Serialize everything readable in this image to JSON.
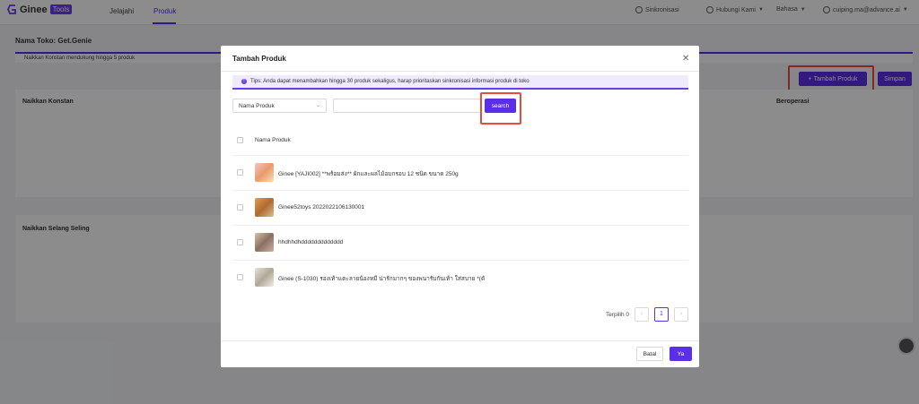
{
  "app": {
    "logo_text": "Ginee",
    "logo_badge": "Tools",
    "nav": [
      {
        "label": "Jelajahi"
      },
      {
        "label": "Produk"
      }
    ],
    "top_right": {
      "sync": "Sinkronisasi",
      "contact": "Hubungi Kami",
      "language": "Bahasa",
      "user": "cuiping.ma@advance.ai"
    },
    "accent_color": "#5b2ee8"
  },
  "page": {
    "store_title": "Nama Toko: Get.Genie",
    "tip": "Naikkan Konstan mendukung hingga 5 produk",
    "add_button": "+ Tambah Produk",
    "save_button": "Simpan",
    "section1_label": "Naikkan Konstan",
    "section1_op": "Beroperasi",
    "section2_label": "Naikkan Selang Seling"
  },
  "modal": {
    "title": "Tambah Produk",
    "close_icon": "close-icon",
    "tips": "Tips: Anda dapat menambahkan hingga 30 produk sekaligus, harap prioritaskan sinkronisasi informasi produk di toko",
    "select_value": "Nama Produk",
    "search_placeholder": "",
    "search_button": "search",
    "column_header": "Nama Produk",
    "products": [
      {
        "name": "Ginee [YAJI002] **พร้อมส่ง** ผักและผลไม้อบกรอบ 12 ชนิด ขนาด 250g"
      },
      {
        "name": "Ginee52toys 2022022106130001"
      },
      {
        "name": "hhdhhdhddddddddddddd"
      },
      {
        "name": "Ginee (S-1030) รองเท้าแตะลายน้องหมี น่ารักมากๆ ของพนารับกันเท้า ใส่สบาย *(ดั"
      }
    ],
    "selected_label": "Terpilih 0",
    "current_page": "1",
    "cancel_button": "Batal",
    "ok_button": "Ya"
  }
}
